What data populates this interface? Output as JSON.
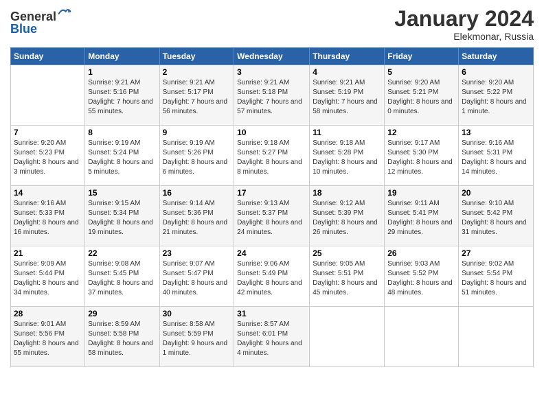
{
  "header": {
    "logo_line1": "General",
    "logo_line2": "Blue",
    "month_title": "January 2024",
    "location": "Elekmonar, Russia"
  },
  "days_of_week": [
    "Sunday",
    "Monday",
    "Tuesday",
    "Wednesday",
    "Thursday",
    "Friday",
    "Saturday"
  ],
  "weeks": [
    [
      {
        "day": "",
        "sunrise": "",
        "sunset": "",
        "daylight": ""
      },
      {
        "day": "1",
        "sunrise": "Sunrise: 9:21 AM",
        "sunset": "Sunset: 5:16 PM",
        "daylight": "Daylight: 7 hours and 55 minutes."
      },
      {
        "day": "2",
        "sunrise": "Sunrise: 9:21 AM",
        "sunset": "Sunset: 5:17 PM",
        "daylight": "Daylight: 7 hours and 56 minutes."
      },
      {
        "day": "3",
        "sunrise": "Sunrise: 9:21 AM",
        "sunset": "Sunset: 5:18 PM",
        "daylight": "Daylight: 7 hours and 57 minutes."
      },
      {
        "day": "4",
        "sunrise": "Sunrise: 9:21 AM",
        "sunset": "Sunset: 5:19 PM",
        "daylight": "Daylight: 7 hours and 58 minutes."
      },
      {
        "day": "5",
        "sunrise": "Sunrise: 9:20 AM",
        "sunset": "Sunset: 5:21 PM",
        "daylight": "Daylight: 8 hours and 0 minutes."
      },
      {
        "day": "6",
        "sunrise": "Sunrise: 9:20 AM",
        "sunset": "Sunset: 5:22 PM",
        "daylight": "Daylight: 8 hours and 1 minute."
      }
    ],
    [
      {
        "day": "7",
        "sunrise": "Sunrise: 9:20 AM",
        "sunset": "Sunset: 5:23 PM",
        "daylight": "Daylight: 8 hours and 3 minutes."
      },
      {
        "day": "8",
        "sunrise": "Sunrise: 9:19 AM",
        "sunset": "Sunset: 5:24 PM",
        "daylight": "Daylight: 8 hours and 5 minutes."
      },
      {
        "day": "9",
        "sunrise": "Sunrise: 9:19 AM",
        "sunset": "Sunset: 5:26 PM",
        "daylight": "Daylight: 8 hours and 6 minutes."
      },
      {
        "day": "10",
        "sunrise": "Sunrise: 9:18 AM",
        "sunset": "Sunset: 5:27 PM",
        "daylight": "Daylight: 8 hours and 8 minutes."
      },
      {
        "day": "11",
        "sunrise": "Sunrise: 9:18 AM",
        "sunset": "Sunset: 5:28 PM",
        "daylight": "Daylight: 8 hours and 10 minutes."
      },
      {
        "day": "12",
        "sunrise": "Sunrise: 9:17 AM",
        "sunset": "Sunset: 5:30 PM",
        "daylight": "Daylight: 8 hours and 12 minutes."
      },
      {
        "day": "13",
        "sunrise": "Sunrise: 9:16 AM",
        "sunset": "Sunset: 5:31 PM",
        "daylight": "Daylight: 8 hours and 14 minutes."
      }
    ],
    [
      {
        "day": "14",
        "sunrise": "Sunrise: 9:16 AM",
        "sunset": "Sunset: 5:33 PM",
        "daylight": "Daylight: 8 hours and 16 minutes."
      },
      {
        "day": "15",
        "sunrise": "Sunrise: 9:15 AM",
        "sunset": "Sunset: 5:34 PM",
        "daylight": "Daylight: 8 hours and 19 minutes."
      },
      {
        "day": "16",
        "sunrise": "Sunrise: 9:14 AM",
        "sunset": "Sunset: 5:36 PM",
        "daylight": "Daylight: 8 hours and 21 minutes."
      },
      {
        "day": "17",
        "sunrise": "Sunrise: 9:13 AM",
        "sunset": "Sunset: 5:37 PM",
        "daylight": "Daylight: 8 hours and 24 minutes."
      },
      {
        "day": "18",
        "sunrise": "Sunrise: 9:12 AM",
        "sunset": "Sunset: 5:39 PM",
        "daylight": "Daylight: 8 hours and 26 minutes."
      },
      {
        "day": "19",
        "sunrise": "Sunrise: 9:11 AM",
        "sunset": "Sunset: 5:41 PM",
        "daylight": "Daylight: 8 hours and 29 minutes."
      },
      {
        "day": "20",
        "sunrise": "Sunrise: 9:10 AM",
        "sunset": "Sunset: 5:42 PM",
        "daylight": "Daylight: 8 hours and 31 minutes."
      }
    ],
    [
      {
        "day": "21",
        "sunrise": "Sunrise: 9:09 AM",
        "sunset": "Sunset: 5:44 PM",
        "daylight": "Daylight: 8 hours and 34 minutes."
      },
      {
        "day": "22",
        "sunrise": "Sunrise: 9:08 AM",
        "sunset": "Sunset: 5:45 PM",
        "daylight": "Daylight: 8 hours and 37 minutes."
      },
      {
        "day": "23",
        "sunrise": "Sunrise: 9:07 AM",
        "sunset": "Sunset: 5:47 PM",
        "daylight": "Daylight: 8 hours and 40 minutes."
      },
      {
        "day": "24",
        "sunrise": "Sunrise: 9:06 AM",
        "sunset": "Sunset: 5:49 PM",
        "daylight": "Daylight: 8 hours and 42 minutes."
      },
      {
        "day": "25",
        "sunrise": "Sunrise: 9:05 AM",
        "sunset": "Sunset: 5:51 PM",
        "daylight": "Daylight: 8 hours and 45 minutes."
      },
      {
        "day": "26",
        "sunrise": "Sunrise: 9:03 AM",
        "sunset": "Sunset: 5:52 PM",
        "daylight": "Daylight: 8 hours and 48 minutes."
      },
      {
        "day": "27",
        "sunrise": "Sunrise: 9:02 AM",
        "sunset": "Sunset: 5:54 PM",
        "daylight": "Daylight: 8 hours and 51 minutes."
      }
    ],
    [
      {
        "day": "28",
        "sunrise": "Sunrise: 9:01 AM",
        "sunset": "Sunset: 5:56 PM",
        "daylight": "Daylight: 8 hours and 55 minutes."
      },
      {
        "day": "29",
        "sunrise": "Sunrise: 8:59 AM",
        "sunset": "Sunset: 5:58 PM",
        "daylight": "Daylight: 8 hours and 58 minutes."
      },
      {
        "day": "30",
        "sunrise": "Sunrise: 8:58 AM",
        "sunset": "Sunset: 5:59 PM",
        "daylight": "Daylight: 9 hours and 1 minute."
      },
      {
        "day": "31",
        "sunrise": "Sunrise: 8:57 AM",
        "sunset": "Sunset: 6:01 PM",
        "daylight": "Daylight: 9 hours and 4 minutes."
      },
      {
        "day": "",
        "sunrise": "",
        "sunset": "",
        "daylight": ""
      },
      {
        "day": "",
        "sunrise": "",
        "sunset": "",
        "daylight": ""
      },
      {
        "day": "",
        "sunrise": "",
        "sunset": "",
        "daylight": ""
      }
    ]
  ]
}
